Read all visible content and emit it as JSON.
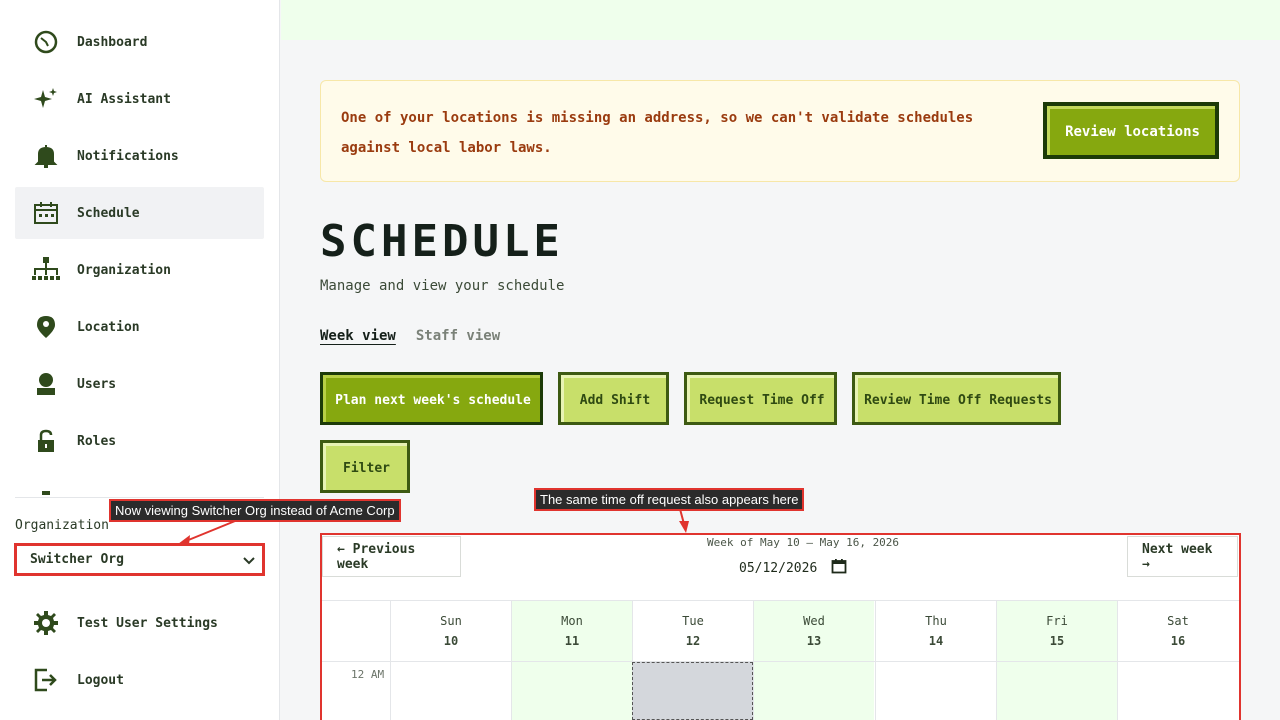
{
  "sidebar": {
    "items": [
      {
        "label": "Dashboard",
        "icon": "dashboard-icon"
      },
      {
        "label": "AI Assistant",
        "icon": "sparkle-icon"
      },
      {
        "label": "Notifications",
        "icon": "bell-icon"
      },
      {
        "label": "Schedule",
        "icon": "calendar-icon",
        "active": true
      },
      {
        "label": "Organization",
        "icon": "org-chart-icon"
      },
      {
        "label": "Location",
        "icon": "location-pin-icon"
      },
      {
        "label": "Users",
        "icon": "user-icon"
      },
      {
        "label": "Roles",
        "icon": "lock-icon"
      }
    ],
    "org_label": "Organization",
    "org_selected": "Switcher Org",
    "bottom_items": [
      {
        "label": "Test User Settings",
        "icon": "gear-icon"
      },
      {
        "label": "Logout",
        "icon": "logout-icon"
      }
    ]
  },
  "alert": {
    "text": "One of your locations is missing an address, so we can't validate schedules against local labor laws.",
    "button": "Review locations"
  },
  "page": {
    "title": "SCHEDULE",
    "subtitle": "Manage and view your schedule",
    "tabs": {
      "week": "Week view",
      "staff": "Staff view"
    }
  },
  "actions": {
    "plan": "Plan next week's schedule",
    "add_shift": "Add Shift",
    "request_time_off": "Request Time Off",
    "review_time_off": "Review Time Off Requests",
    "filter": "Filter"
  },
  "annotations": {
    "org_note": "Now viewing Switcher Org instead of Acme Corp",
    "calendar_note": "The same time off request also appears here"
  },
  "calendar": {
    "prev": "← Previous week",
    "next": "Next week →",
    "week_label": "Week of May 10 – May 16, 2026",
    "date_value": "05/12/2026",
    "days": [
      {
        "name": "Sun",
        "num": "10"
      },
      {
        "name": "Mon",
        "num": "11"
      },
      {
        "name": "Tue",
        "num": "12"
      },
      {
        "name": "Wed",
        "num": "13"
      },
      {
        "name": "Thu",
        "num": "14"
      },
      {
        "name": "Fri",
        "num": "15"
      },
      {
        "name": "Sat",
        "num": "16"
      }
    ],
    "first_time": "12 AM"
  },
  "colors": {
    "accent": "#86a80f",
    "accent_dark": "#1c3a08",
    "alert_text": "#9a3b0f",
    "annotation": "#e0342e"
  }
}
